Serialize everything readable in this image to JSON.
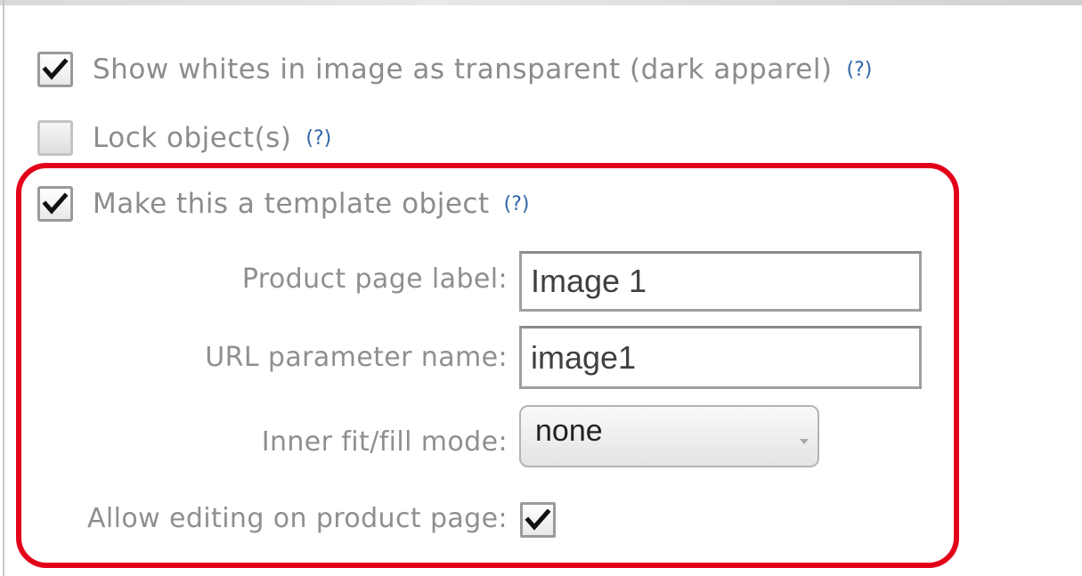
{
  "options": {
    "transparent_whites": {
      "label": "Show whites in image as transparent (dark apparel)",
      "help": "(?)",
      "checked": true
    },
    "lock_objects": {
      "label": "Lock object(s)",
      "help": "(?)",
      "checked": false
    },
    "template_object": {
      "label": "Make this a template object",
      "help": "(?)",
      "checked": true
    }
  },
  "template_settings": {
    "product_page_label": {
      "label": "Product page label:",
      "value": "Image 1"
    },
    "url_parameter_name": {
      "label": "URL parameter name:",
      "value": "image1"
    },
    "fit_fill_mode": {
      "label": "Inner fit/fill mode:",
      "value": "none"
    },
    "allow_editing": {
      "label": "Allow editing on product page:",
      "checked": true
    }
  },
  "colors": {
    "highlight": "#e3001b",
    "help_link": "#2e66a8",
    "label_text": "#8c8c8c"
  }
}
